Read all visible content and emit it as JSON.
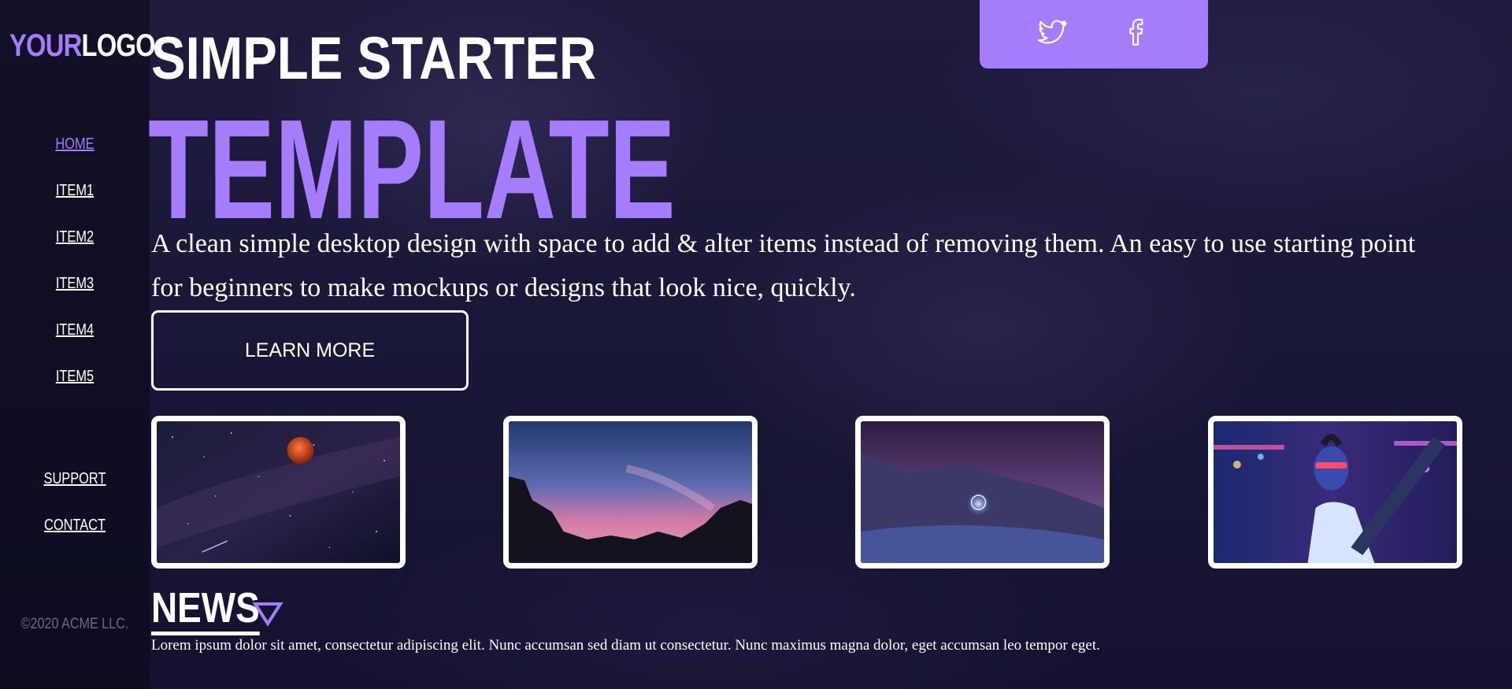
{
  "logo": {
    "part1": "YOUR",
    "part2": "LOGO"
  },
  "nav": {
    "items": [
      {
        "label": "HOME",
        "active": true
      },
      {
        "label": "ITEM1"
      },
      {
        "label": "ITEM2"
      },
      {
        "label": "ITEM3"
      },
      {
        "label": "ITEM4"
      },
      {
        "label": "ITEM5"
      }
    ],
    "footer_items": [
      {
        "label": "SUPPORT"
      },
      {
        "label": "CONTACT"
      }
    ],
    "copyright": "©2020 ACME LLC."
  },
  "social": {
    "icons": [
      "twitter-icon",
      "facebook-icon"
    ],
    "background": "#a47cfc"
  },
  "hero": {
    "title_line1": "SIMPLE STARTER",
    "title_line2": "TEMPLATE",
    "description": "A clean simple desktop design with space to add & alter items instead of removing them. An easy to use starting point for beginners to make mockups or designs that look nice, quickly.",
    "button_label": "LEARN MORE"
  },
  "gallery": {
    "images": [
      "night-sky-moon-image",
      "desert-sunset-rocks-image",
      "snowy-mountain-light-orb-image",
      "neon-person-portrait-image"
    ]
  },
  "news": {
    "heading": "NEWS",
    "text": "Lorem ipsum dolor sit amet, consectetur adipiscing elit. Nunc accumsan sed diam ut consectetur. Nunc maximus magna dolor, eget accumsan leo tempor eget."
  },
  "colors": {
    "accent": "#a47cfc",
    "background": "#171535",
    "text": "#ffffff",
    "muted": "#6e6a80"
  }
}
